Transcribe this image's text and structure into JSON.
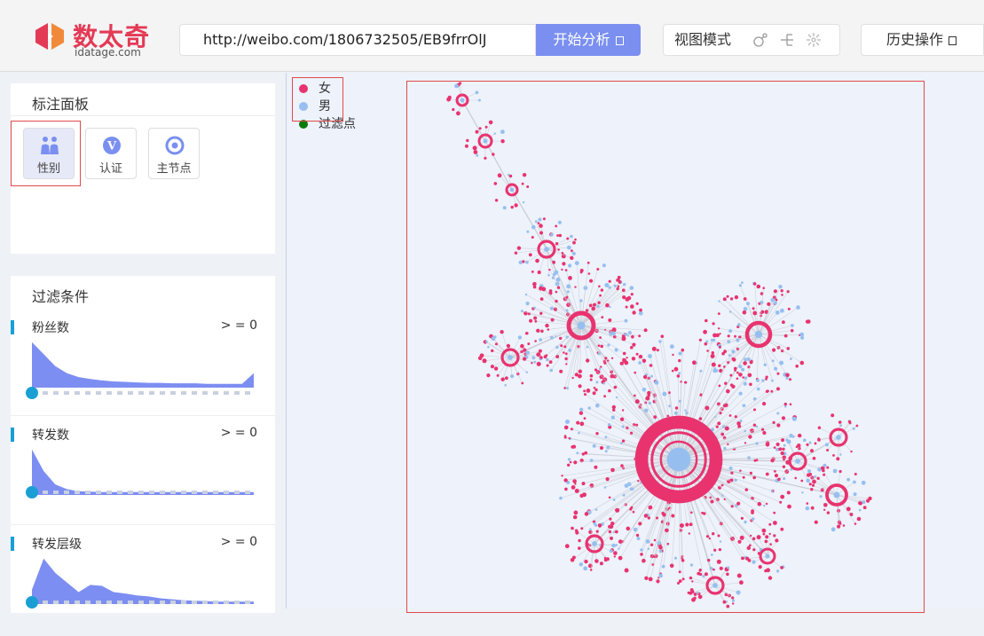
{
  "header": {
    "logo_text": "数太奇",
    "logo_sub": "idatage.com",
    "url_value": "http://weibo.com/1806732505/EB9frrOlJ",
    "start_label": "开始分析",
    "view_mode_label": "视图模式",
    "history_label": "历史操作"
  },
  "annotation_panel": {
    "title": "标注面板",
    "buttons": [
      {
        "label": "性别",
        "icon": "gender-icon",
        "selected": true
      },
      {
        "label": "认证",
        "icon": "verified-v-icon",
        "selected": false
      },
      {
        "label": "主节点",
        "icon": "target-icon",
        "selected": false
      }
    ]
  },
  "filter_panel": {
    "title": "过滤条件",
    "items": [
      {
        "name": "粉丝数",
        "condition": "> = 0",
        "histogram": [
          0.95,
          0.7,
          0.45,
          0.3,
          0.22,
          0.18,
          0.15,
          0.13,
          0.12,
          0.11,
          0.1,
          0.1,
          0.09,
          0.09,
          0.09,
          0.08,
          0.08,
          0.08,
          0.08,
          0.3
        ],
        "value": 0
      },
      {
        "name": "转发数",
        "condition": "> = 0",
        "histogram": [
          0.95,
          0.5,
          0.22,
          0.12,
          0.08,
          0.07,
          0.06,
          0.06,
          0.06,
          0.06,
          0.06,
          0.06,
          0.06,
          0.06,
          0.06,
          0.06,
          0.06,
          0.06,
          0.06,
          0.06
        ],
        "value": 0
      },
      {
        "name": "转发层级",
        "condition": "> = 0",
        "histogram": [
          0.3,
          0.95,
          0.65,
          0.45,
          0.25,
          0.4,
          0.38,
          0.25,
          0.22,
          0.18,
          0.16,
          0.12,
          0.1,
          0.08,
          0.07,
          0.06,
          0.05,
          0.05,
          0.05,
          0.05
        ],
        "value": 0
      }
    ]
  },
  "legend": [
    {
      "label": "女",
      "color": "#e8336f"
    },
    {
      "label": "男",
      "color": "#96bff0"
    },
    {
      "label": "过滤点",
      "color": "#0a7a0a"
    }
  ],
  "graph": {
    "female_color": "#e8336f",
    "male_color": "#96bff0",
    "edge_color": "#c9cbd3"
  }
}
